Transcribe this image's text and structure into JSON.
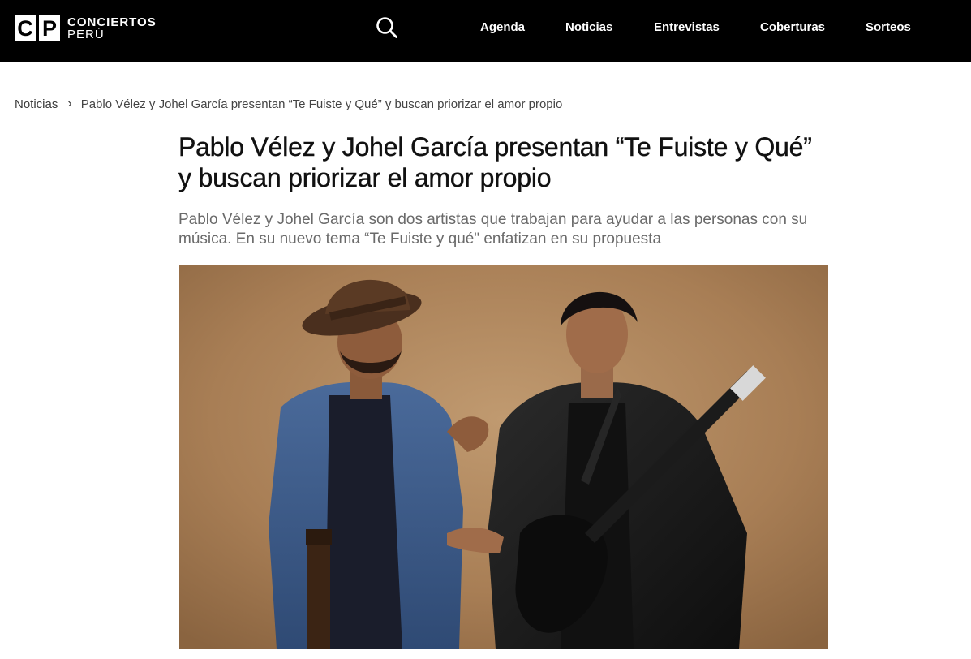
{
  "site": {
    "logo_letters": [
      "C",
      "P"
    ],
    "logo_line1": "CONCIERTOS",
    "logo_line2": "PERÚ"
  },
  "nav": {
    "items": [
      {
        "label": "Agenda"
      },
      {
        "label": "Noticias"
      },
      {
        "label": "Entrevistas"
      },
      {
        "label": "Coberturas"
      },
      {
        "label": "Sorteos"
      }
    ]
  },
  "icons": {
    "search": "search-icon",
    "breadcrumb_sep": "chevron-right-icon"
  },
  "breadcrumb": {
    "section": "Noticias",
    "separator": "›",
    "current": "Pablo Vélez y Johel García presentan “Te Fuiste y Qué” y buscan priorizar el amor propio"
  },
  "article": {
    "title": "Pablo Vélez y Johel García presentan “Te Fuiste y Qué” y buscan priorizar el amor propio",
    "summary": "Pablo Vélez y Johel García son dos artistas que trabajan para ayudar a las personas con su música. En su nuevo tema “Te Fuiste y qué\" enfatizan en su propuesta"
  },
  "colors": {
    "header_bg": "#000000",
    "header_text": "#ffffff",
    "title_text": "#111111",
    "summary_text": "#6a6a6a",
    "photo_backdrop": "#b0865c"
  }
}
